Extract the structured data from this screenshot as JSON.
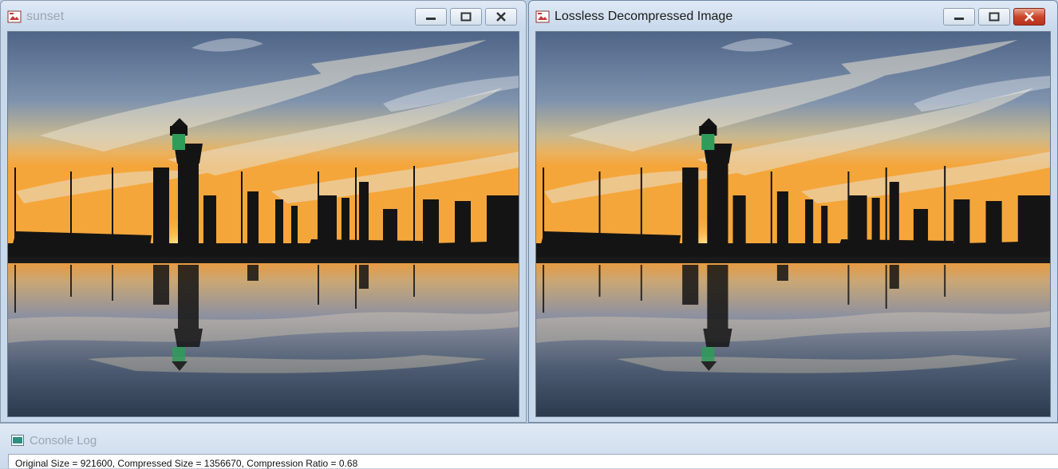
{
  "windows": [
    {
      "title": "sunset",
      "active": false,
      "buttons": {
        "minimize": "minimize",
        "maximize": "maximize",
        "close": "close"
      }
    },
    {
      "title": "Lossless Decompressed Image",
      "active": true,
      "buttons": {
        "minimize": "minimize",
        "maximize": "maximize",
        "close": "close"
      }
    }
  ],
  "image": {
    "subject": "sunset over harbor skyline with lamp post reflected in water",
    "colors": {
      "sky_top": "#5f7596",
      "horizon": "#f2a23a",
      "water": "#3b4a5e",
      "silhouette": "#141414",
      "lamp_glow": "#3fbf6a"
    }
  },
  "console": {
    "title": "Console Log",
    "log_text": "Original Size = 921600, Compressed Size = 1356670, Compression Ratio = 0.68"
  },
  "icons": {
    "app": "image-window-icon",
    "console": "console-window-icon"
  }
}
